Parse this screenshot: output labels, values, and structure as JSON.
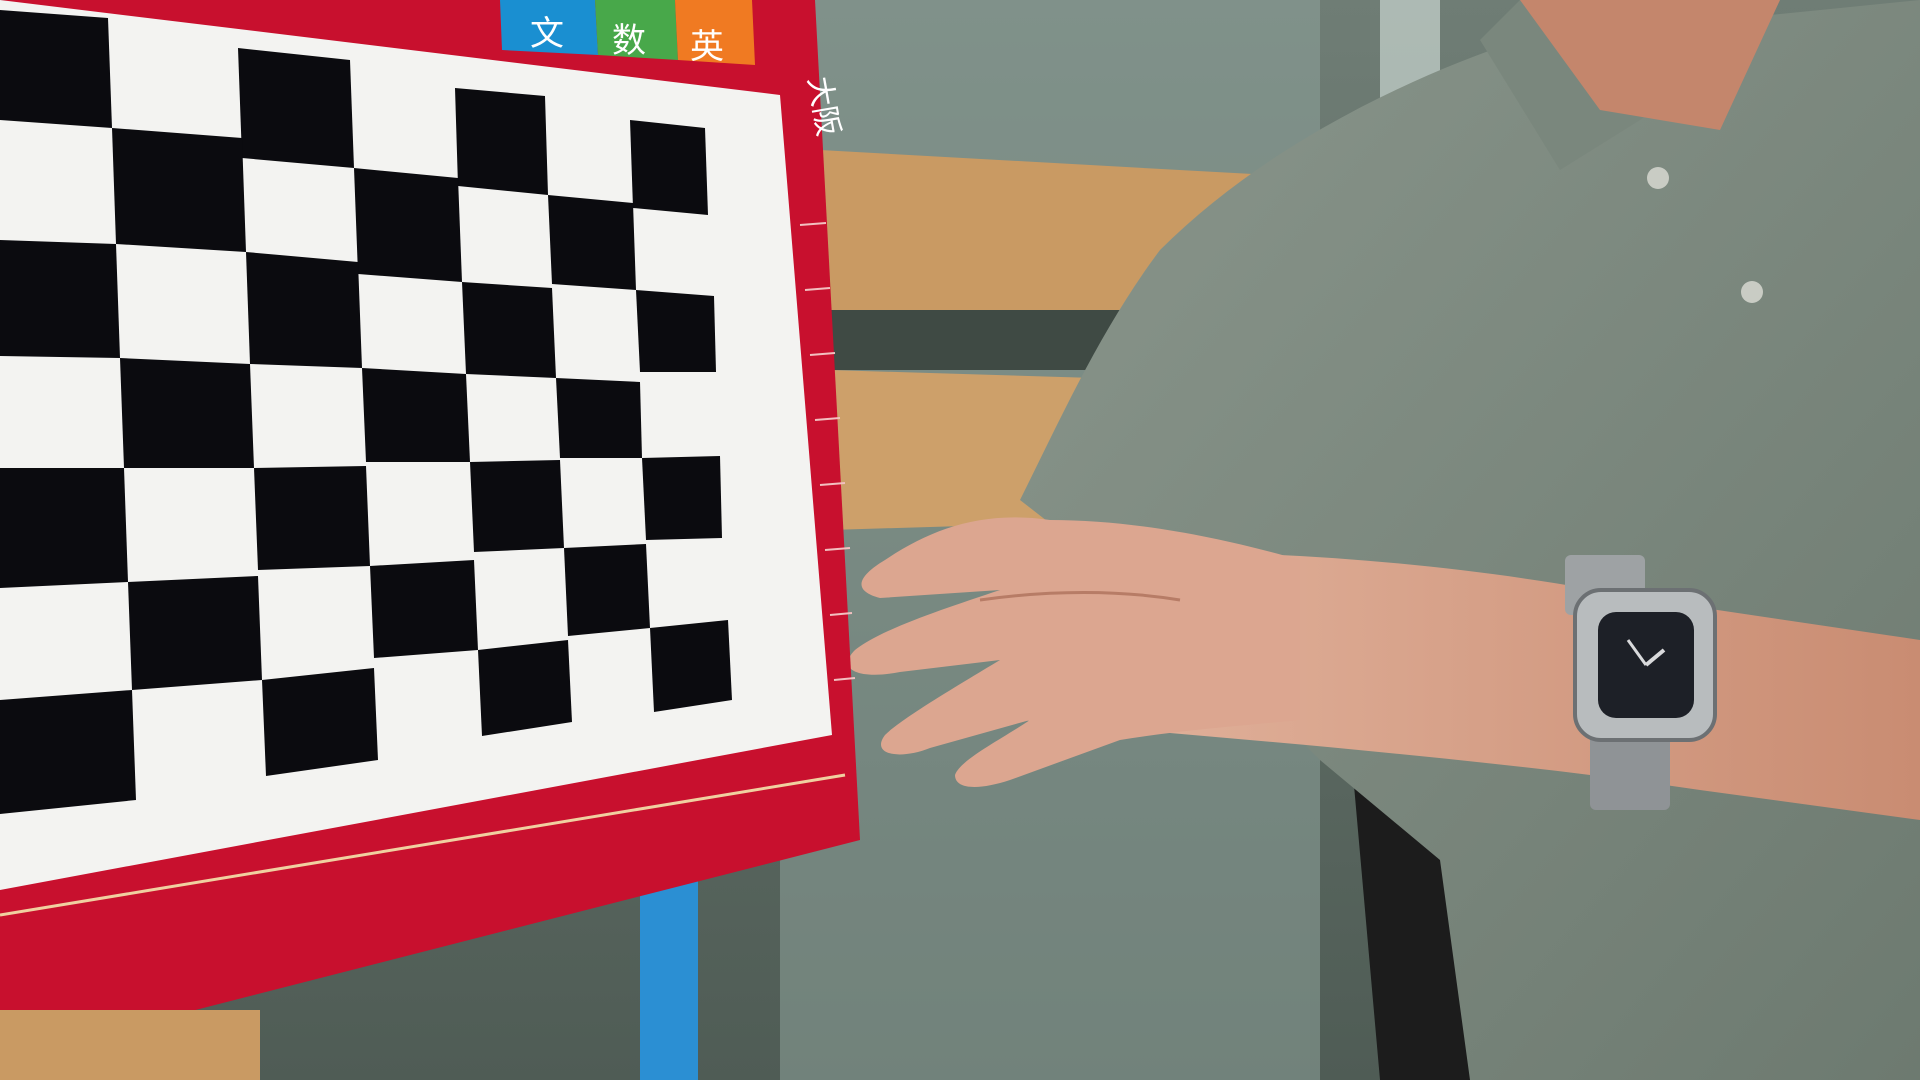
{
  "image": {
    "kind": "photo",
    "subjects": [
      "checkerboard-board",
      "hand",
      "wristwatch",
      "polo-shirt",
      "wooden-shelf",
      "office-chair"
    ]
  },
  "board": {
    "visible_text": [
      "文",
      "数",
      "英",
      "大阪"
    ],
    "colors": {
      "frame": "#c8102e",
      "card": "#f3f3f1",
      "square": "#0b0b0f",
      "tab_blue": "#1a8fd1",
      "tab_green": "#48a84a",
      "tab_orange": "#f07a22"
    }
  },
  "colors": {
    "shirt": "#7e8a80",
    "skin": "#d8a088",
    "wood": "#c99a63",
    "glass": "#8ea39b"
  }
}
